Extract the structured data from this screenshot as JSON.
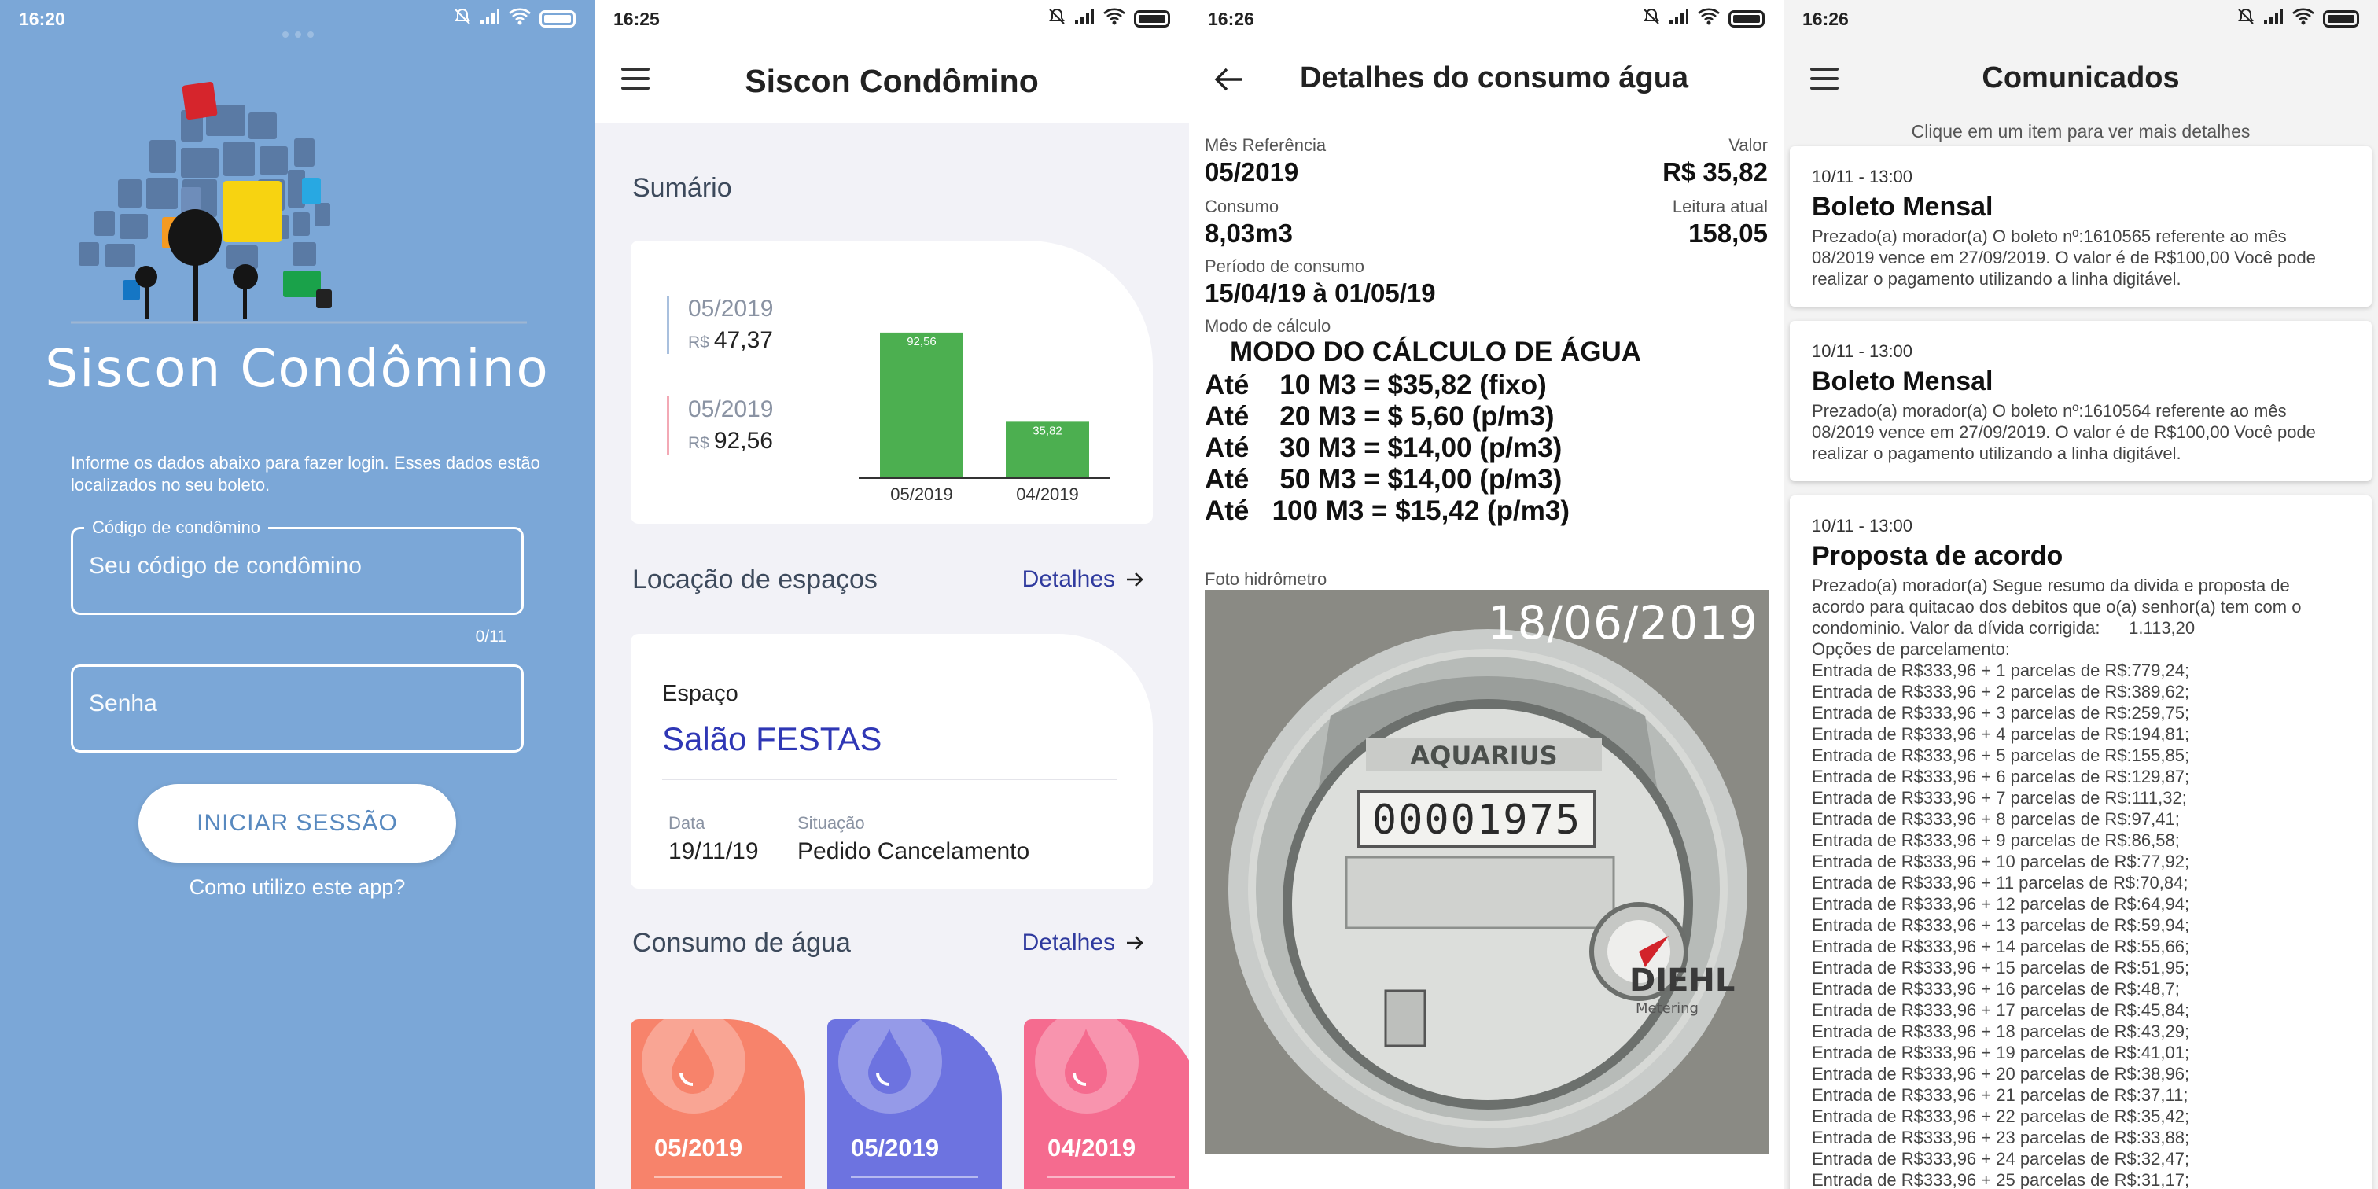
{
  "login": {
    "time": "16:20",
    "brand_title": "Siscon Condômino",
    "info": "Informe os dados abaixo para fazer login. Esses dados estão localizados no seu boleto.",
    "code_label": "Código de condômino",
    "code_placeholder": "Seu código de condômino",
    "code_counter": "0/11",
    "password_placeholder": "Senha",
    "login_button": "INICIAR SESSÃO",
    "help_link": "Como utilizo este app?"
  },
  "dashboard": {
    "time": "16:25",
    "title": "Siscon Condômino",
    "summary": {
      "title": "Sumário",
      "currency": "R$",
      "items": [
        {
          "date": "05/2019",
          "value": "47,37"
        },
        {
          "date": "05/2019",
          "value": "92,56"
        }
      ]
    },
    "chart_data": {
      "type": "bar",
      "categories": [
        "05/2019",
        "04/2019"
      ],
      "values": [
        92.56,
        35.82
      ],
      "data_labels": [
        "92,56",
        "35,82"
      ],
      "ylim": [
        0,
        100
      ],
      "color": "#4caf50"
    },
    "rentals": {
      "title": "Locação de espaços",
      "details_label": "Detalhes",
      "space_label": "Espaço",
      "space_name": "Salão FESTAS",
      "date_label": "Data",
      "date_value": "19/11/19",
      "status_label": "Situação",
      "status_value": "Pedido Cancelamento"
    },
    "water": {
      "title": "Consumo de água",
      "details_label": "Detalhes",
      "cards": [
        {
          "date": "05/2019",
          "color": "#f7836b"
        },
        {
          "date": "05/2019",
          "color": "#6d73e0"
        },
        {
          "date": "04/2019",
          "color": "#f56b8f"
        }
      ]
    }
  },
  "water_details": {
    "time": "16:26",
    "title": "Detalhes do consumo água",
    "ref_month_label": "Mês Referência",
    "ref_month": "05/2019",
    "value_label": "Valor",
    "value": "R$ 35,82",
    "consumption_label": "Consumo",
    "consumption": "8,03m3",
    "reading_label": "Leitura atual",
    "reading": "158,05",
    "period_label": "Período de consumo",
    "period": "15/04/19 à 01/05/19",
    "calc_label": "Modo de cálculo",
    "calc_title": "MODO DO CÁLCULO DE ÁGUA",
    "calc_lines": [
      "Até    10 M3 = $35,82 (fixo)",
      "Até    20 M3 = $ 5,60 (p/m3)",
      "Até    30 M3 = $14,00 (p/m3)",
      "Até    50 M3 = $14,00 (p/m3)",
      "Até   100 M3 = $15,42 (p/m3)"
    ],
    "photo_label": "Foto hidrômetro",
    "photo_date": "18/06/2019",
    "meter_brand": "AQUARIUS",
    "meter_reading": "00001975",
    "meter_maker": "DIEHL",
    "meter_maker_sub": "Metering"
  },
  "announcements": {
    "time": "16:26",
    "title": "Comunicados",
    "hint": "Clique em um item para ver mais detalhes",
    "items": [
      {
        "date": "10/11 - 13:00",
        "title": "Boleto Mensal",
        "lines": [
          "Prezado(a) morador(a) O boleto nº:1610565 referente ao mês",
          "08/2019 vence em 27/09/2019. O valor é de R$100,00 Você pode",
          "realizar o pagamento utilizando a linha digitável."
        ]
      },
      {
        "date": "10/11 - 13:00",
        "title": "Boleto Mensal",
        "lines": [
          "Prezado(a) morador(a) O boleto nº:1610564 referente ao mês",
          "08/2019 vence em 27/09/2019. O valor é de R$100,00 Você pode",
          "realizar o pagamento utilizando a linha digitável."
        ]
      },
      {
        "date": "10/11 - 13:00",
        "title": "Proposta de acordo",
        "lines": [
          "Prezado(a) morador(a) Segue resumo da divida e proposta de",
          "acordo para quitacao dos debitos que o(a) senhor(a) tem com o",
          "condominio. Valor da dívida corrigida:      1.113,20",
          "Opções de parcelamento:",
          "Entrada de R$333,96 + 1 parcelas de R$:779,24;",
          "Entrada de R$333,96 + 2 parcelas de R$:389,62;",
          "Entrada de R$333,96 + 3 parcelas de R$:259,75;",
          "Entrada de R$333,96 + 4 parcelas de R$:194,81;",
          "Entrada de R$333,96 + 5 parcelas de R$:155,85;",
          "Entrada de R$333,96 + 6 parcelas de R$:129,87;",
          "Entrada de R$333,96 + 7 parcelas de R$:111,32;",
          "Entrada de R$333,96 + 8 parcelas de R$:97,41;",
          "Entrada de R$333,96 + 9 parcelas de R$:86,58;",
          "Entrada de R$333,96 + 10 parcelas de R$:77,92;",
          "Entrada de R$333,96 + 11 parcelas de R$:70,84;",
          "Entrada de R$333,96 + 12 parcelas de R$:64,94;",
          "Entrada de R$333,96 + 13 parcelas de R$:59,94;",
          "Entrada de R$333,96 + 14 parcelas de R$:55,66;",
          "Entrada de R$333,96 + 15 parcelas de R$:51,95;",
          "Entrada de R$333,96 + 16 parcelas de R$:48,7;",
          "Entrada de R$333,96 + 17 parcelas de R$:45,84;",
          "Entrada de R$333,96 + 18 parcelas de R$:43,29;",
          "Entrada de R$333,96 + 19 parcelas de R$:41,01;",
          "Entrada de R$333,96 + 20 parcelas de R$:38,96;",
          "Entrada de R$333,96 + 21 parcelas de R$:37,11;",
          "Entrada de R$333,96 + 22 parcelas de R$:35,42;",
          "Entrada de R$333,96 + 23 parcelas de R$:33,88;",
          "Entrada de R$333,96 + 24 parcelas de R$:32,47;",
          "Entrada de R$333,96 + 25 parcelas de R$:31,17;"
        ]
      }
    ]
  }
}
